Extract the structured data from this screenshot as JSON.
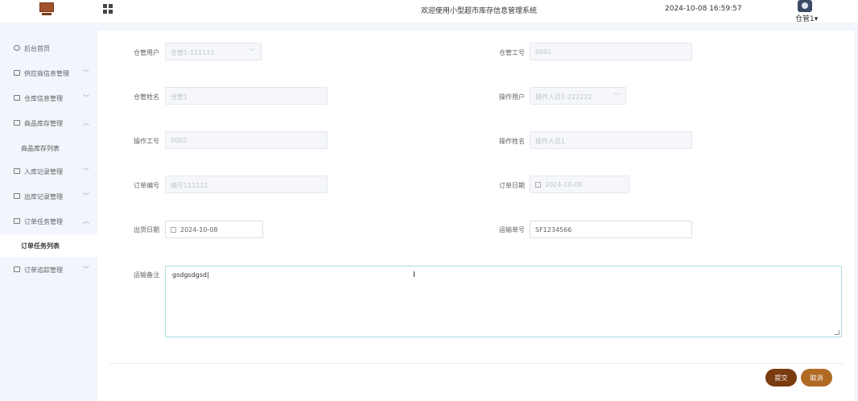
{
  "header": {
    "title": "欢迎使用小型超市库存信息管理系统",
    "datetime": "2024-10-08 16:59:57",
    "user": "仓管1"
  },
  "sidebar": {
    "items": [
      {
        "label": "后台首页",
        "icon": "clock-icon"
      },
      {
        "label": "供应商信息管理",
        "icon": "folder-icon",
        "expanded": false
      },
      {
        "label": "仓库信息管理",
        "icon": "folder-icon",
        "expanded": false
      },
      {
        "label": "商品库存管理",
        "icon": "folder-icon",
        "expanded": true
      },
      {
        "label": "商品库存列表",
        "sub": true
      },
      {
        "label": "入库记录管理",
        "icon": "folder-icon",
        "expanded": false
      },
      {
        "label": "出库记录管理",
        "icon": "folder-icon",
        "expanded": false
      },
      {
        "label": "订单任务管理",
        "icon": "folder-icon",
        "expanded": true
      },
      {
        "label": "订单任务列表",
        "sub": true,
        "active": true
      },
      {
        "label": "订单追踪管理",
        "icon": "folder-icon",
        "expanded": false
      }
    ]
  },
  "form": {
    "warehouse_user": {
      "label": "仓管用户",
      "value": "仓管1-111111"
    },
    "warehouse_no": {
      "label": "仓管工号",
      "value": "0001"
    },
    "warehouse_name": {
      "label": "仓管姓名",
      "value": "仓管1"
    },
    "operator_user": {
      "label": "操作用户",
      "value": "操作人员1-222222"
    },
    "operator_no": {
      "label": "操作工号",
      "value": "0002"
    },
    "operator_name": {
      "label": "操作姓名",
      "value": "操作人员1"
    },
    "order_no": {
      "label": "订单编号",
      "value": "编号111111"
    },
    "order_date": {
      "label": "订单日期",
      "value": "2024-10-08"
    },
    "ship_date": {
      "label": "出货日期",
      "value": "2024-10-08"
    },
    "tracking_no": {
      "label": "运输单号",
      "value": "SF1234566"
    },
    "remark": {
      "label": "运输备注",
      "value": "gsdgsdgsd"
    }
  },
  "buttons": {
    "submit": "提交",
    "cancel": "取消"
  },
  "colors": {
    "accent_dark": "#7a3b0f",
    "accent": "#b06a24",
    "textarea_focus": "#a8dfe0"
  }
}
